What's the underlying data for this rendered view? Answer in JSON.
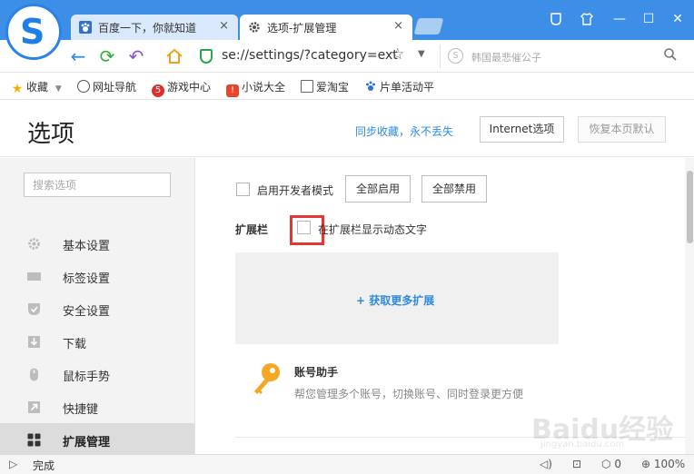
{
  "window": {
    "tabs": [
      {
        "title": "百度一下，你就知道",
        "close": "×"
      },
      {
        "title": "选项-扩展管理",
        "close": "×"
      }
    ],
    "controls": {
      "minimize": "—",
      "maximize": "☐",
      "close": "✕"
    }
  },
  "navbar": {
    "back": "←",
    "refresh": "⟳",
    "undo": "↶",
    "url": "se://settings/?category=ext",
    "search_placeholder": "韩国最悲催公子",
    "search_engine_icon": "S"
  },
  "bookmarks": [
    {
      "label": "收藏",
      "icon": "star-icon"
    },
    {
      "label": "网址导航",
      "icon": "globe-icon"
    },
    {
      "label": "游戏中心",
      "icon": "game-icon"
    },
    {
      "label": "小说大全",
      "icon": "book-icon"
    },
    {
      "label": "爱淘宝",
      "icon": "page-icon"
    },
    {
      "label": "片单活动平",
      "icon": "paw-icon"
    }
  ],
  "header": {
    "title": "选项",
    "sync_link": "同步收藏，永不丢失",
    "internet_options": "Internet选项",
    "reset_defaults": "恢复本页默认"
  },
  "sidebar": {
    "search_placeholder": "搜索选项",
    "items": [
      {
        "label": "基本设置",
        "icon": "gear-icon"
      },
      {
        "label": "标签设置",
        "icon": "tab-icon"
      },
      {
        "label": "安全设置",
        "icon": "shield-icon"
      },
      {
        "label": "下载",
        "icon": "download-icon"
      },
      {
        "label": "鼠标手势",
        "icon": "mouse-icon"
      },
      {
        "label": "快捷键",
        "icon": "shortcut-icon"
      },
      {
        "label": "扩展管理",
        "icon": "grid-icon",
        "active": true
      }
    ]
  },
  "main": {
    "dev_mode_label": "启用开发者模式",
    "enable_all": "全部启用",
    "disable_all": "全部禁用",
    "ext_bar_label": "扩展栏",
    "dynamic_text_label": "在扩展栏显示动态文字",
    "get_more": "+ 获取更多扩展",
    "extension": {
      "name": "账号助手",
      "description": "帮您管理多个账号，切换账号、同时登录更方便"
    }
  },
  "statusbar": {
    "status": "完成",
    "counter": "0",
    "zoom": "100%"
  },
  "watermark": {
    "line1": "Baidu经验",
    "line2": "jingyan.baidu.com"
  },
  "colors": {
    "titlebar": "#3d8ee6",
    "link": "#2f8ae0",
    "highlight": "#e53535",
    "key_icon": "#f5a623"
  }
}
